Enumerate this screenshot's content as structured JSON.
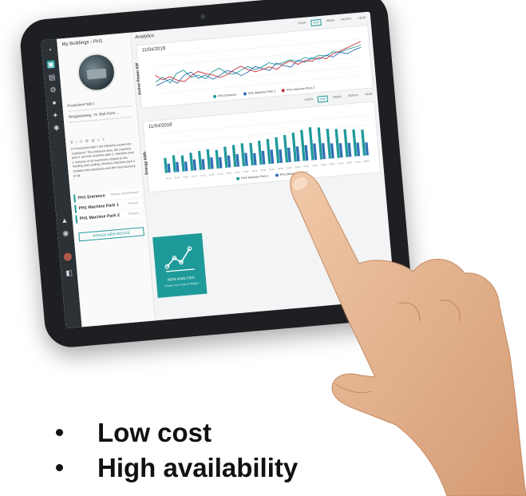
{
  "app": {
    "breadcrumb": "My Buildings › PH1",
    "section_title": "Analytics"
  },
  "building": {
    "name": "Production hall 1",
    "address": "Ortsgrenzweg, 74, Bad Pyrm...",
    "toolbar": "B I U ≣ ≣ ≡ ≡",
    "description": "In Production Hall 1 the following assets are monitored: The entrance area, the machine park 1 and the machine park 2. Machine park 1 consists of all machinery related to the heating and cooling, whereas Machine park 2 contains the processes and the heat recovery of all",
    "devices": [
      {
        "name": "PH1 Entrance",
        "meta": "Phoenix, Fluid Payment"
      },
      {
        "name": "PH1 Machine Park 1",
        "meta": "Phoenix..."
      },
      {
        "name": "PH1 Machine Park 2",
        "meta": "Phoenix..."
      }
    ],
    "assign_label": "ASSIGN NEW DEVICE"
  },
  "period_tabs": [
    "HOUR",
    "DAY",
    "WEEK",
    "MONTH",
    "YEAR"
  ],
  "selected_period": "DAY",
  "new_analysis": {
    "title": "NEW ANALYSIS",
    "subtitle": "Create your Analysis Widget"
  },
  "colors": {
    "teal": "#1f9a9a",
    "line_red": "#c8323c",
    "line_blue": "#2f6fb5",
    "line_teal": "#1f9a9a",
    "rail": "#2c3136"
  },
  "chart_data": [
    {
      "type": "line",
      "title": "11/04/2018",
      "ylabel": "Active Power kW",
      "x": [
        0,
        1,
        2,
        3,
        4,
        5,
        6,
        7,
        8,
        9,
        10,
        11,
        12,
        13,
        14,
        15,
        16,
        17,
        18,
        19,
        20,
        21,
        22,
        23,
        24,
        25,
        26,
        27,
        28,
        29
      ],
      "series": [
        {
          "name": "PH1 Entrance",
          "color": "#1f9a9a",
          "values": [
            42,
            50,
            38,
            55,
            60,
            45,
            48,
            40,
            52,
            58,
            47,
            44,
            50,
            56,
            49,
            53,
            60,
            55,
            58,
            62,
            57,
            64,
            60,
            66,
            63,
            70,
            68,
            72,
            75,
            78
          ]
        },
        {
          "name": "PH1 Machine Park 1",
          "color": "#2f6fb5",
          "values": [
            35,
            40,
            45,
            36,
            50,
            55,
            42,
            47,
            38,
            44,
            52,
            48,
            40,
            46,
            55,
            50,
            45,
            58,
            52,
            48,
            60,
            55,
            62,
            58,
            65,
            60,
            68,
            64,
            70,
            74
          ]
        },
        {
          "name": "PH1 Machine Park 2",
          "color": "#c8323c",
          "values": [
            55,
            45,
            50,
            42,
            38,
            48,
            55,
            50,
            46,
            40,
            44,
            52,
            58,
            50,
            45,
            48,
            52,
            46,
            55,
            60,
            52,
            58,
            56,
            62,
            58,
            66,
            70,
            75,
            80,
            85
          ]
        }
      ],
      "ylim": [
        20,
        90
      ]
    },
    {
      "type": "bar",
      "title": "11/04/2018",
      "ylabel": "Energy kWh",
      "categories": [
        "00:15",
        "00:30",
        "00:45",
        "01:00",
        "01:15",
        "01:30",
        "01:45",
        "02:00",
        "02:15",
        "02:30",
        "02:45",
        "03:00",
        "03:15",
        "03:30",
        "03:45",
        "04:00",
        "04:15",
        "04:30",
        "04:45",
        "05:00",
        "05:15",
        "05:30",
        "05:45",
        "06:00"
      ],
      "series": [
        {
          "name": "PH1 Machine Park 1",
          "color": "#1f9a9a",
          "values": [
            30,
            34,
            32,
            36,
            38,
            40,
            37,
            42,
            44,
            46,
            45,
            48,
            50,
            52,
            55,
            58,
            62,
            66,
            64,
            60,
            58,
            56,
            54,
            52
          ]
        },
        {
          "name": "PH1 Machine Park 2",
          "color": "#2f6fb5",
          "values": [
            18,
            20,
            19,
            22,
            21,
            23,
            22,
            24,
            25,
            26,
            24,
            27,
            28,
            27,
            29,
            30,
            31,
            33,
            32,
            30,
            29,
            28,
            27,
            26
          ]
        }
      ],
      "ylim": [
        0,
        80
      ]
    }
  ],
  "bullets": [
    "Low cost",
    "High availability"
  ]
}
